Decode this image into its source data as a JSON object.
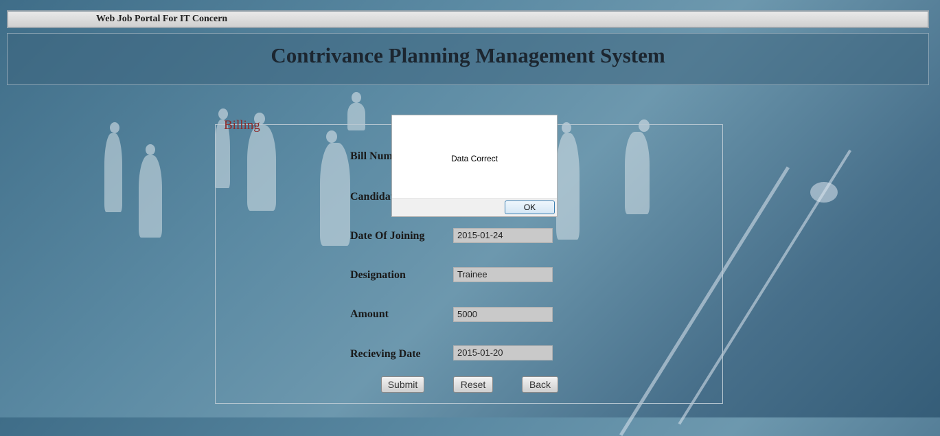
{
  "topbar": {
    "title": "Web Job Portal For IT Concern"
  },
  "header": {
    "title": "Contrivance Planning Management System"
  },
  "form": {
    "legend": "Billing",
    "fields": [
      {
        "label": "Bill Num",
        "value": ""
      },
      {
        "label": "Candidat",
        "value": ""
      },
      {
        "label": "Date Of Joining",
        "value": "2015-01-24"
      },
      {
        "label": "Designation",
        "value": "Trainee"
      },
      {
        "label": "Amount",
        "value": "5000"
      },
      {
        "label": "Recieving Date",
        "value": "2015-01-20"
      }
    ],
    "buttons": {
      "submit": "Submit",
      "reset": "Reset",
      "back": "Back"
    }
  },
  "dialog": {
    "message": "Data Correct",
    "ok_label": "OK"
  }
}
